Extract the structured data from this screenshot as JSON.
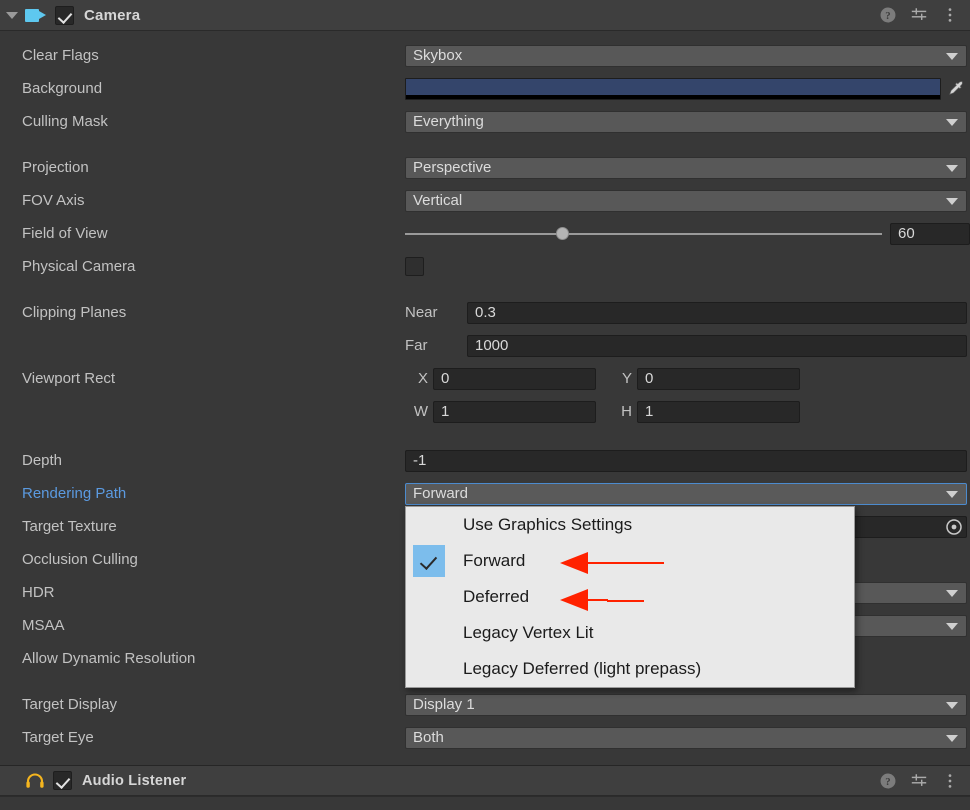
{
  "camera_component": {
    "title": "Camera",
    "icon": "camera-icon",
    "enabled": true,
    "help_icon": "help-icon",
    "preset_icon": "preset-settings-icon",
    "menu_icon": "more-options-icon"
  },
  "audio_component": {
    "title": "Audio Listener",
    "icon": "headphones-icon",
    "enabled": true,
    "help_icon": "help-icon",
    "preset_icon": "preset-settings-icon",
    "menu_icon": "more-options-icon"
  },
  "properties": {
    "clear_flags": {
      "label": "Clear Flags",
      "value": "Skybox"
    },
    "background": {
      "label": "Background",
      "color": "#34456B",
      "alpha_color": "#000000",
      "eyedropper_icon": "eyedropper-icon"
    },
    "culling_mask": {
      "label": "Culling Mask",
      "value": "Everything"
    },
    "projection": {
      "label": "Projection",
      "value": "Perspective"
    },
    "fov_axis": {
      "label": "FOV Axis",
      "value": "Vertical"
    },
    "field_of_view": {
      "label": "Field of View",
      "value": "60",
      "slider_percent": 33
    },
    "physical_camera": {
      "label": "Physical Camera",
      "checked": false
    },
    "clipping_planes": {
      "label": "Clipping Planes",
      "near_label": "Near",
      "near_value": "0.3",
      "far_label": "Far",
      "far_value": "1000"
    },
    "viewport_rect": {
      "label": "Viewport Rect",
      "x_label": "X",
      "x_value": "0",
      "y_label": "Y",
      "y_value": "0",
      "w_label": "W",
      "w_value": "1",
      "h_label": "H",
      "h_value": "1"
    },
    "depth": {
      "label": "Depth",
      "value": "-1"
    },
    "rendering_path": {
      "label": "Rendering Path",
      "value": "Forward",
      "focused": true
    },
    "target_texture": {
      "label": "Target Texture",
      "value": "",
      "picker_icon": "object-picker-icon"
    },
    "occlusion_culling": {
      "label": "Occlusion Culling"
    },
    "hdr": {
      "label": "HDR"
    },
    "msaa": {
      "label": "MSAA"
    },
    "allow_dynamic_resolution": {
      "label": "Allow Dynamic Resolution"
    },
    "target_display": {
      "label": "Target Display",
      "value": "Display 1"
    },
    "target_eye": {
      "label": "Target Eye",
      "value": "Both"
    }
  },
  "rendering_path_popup": {
    "items": [
      {
        "label": "Use Graphics Settings",
        "checked": false
      },
      {
        "label": "Forward",
        "checked": true
      },
      {
        "label": "Deferred",
        "checked": false
      },
      {
        "label": "Legacy Vertex Lit",
        "checked": false
      },
      {
        "label": "Legacy Deferred (light prepass)",
        "checked": false
      }
    ]
  },
  "annotations": {
    "color": "#FF2200",
    "arrows": [
      {
        "points_to": "Forward"
      },
      {
        "points_to": "Deferred"
      }
    ]
  },
  "colors": {
    "background": "#383838",
    "header_bar": "#3F3F3F",
    "dropdown": "#585858",
    "text_field": "#282828",
    "accent_blue": "#5B9AE0",
    "focus_blue": "#4C8BCE",
    "popup_bg": "#E9E9E9",
    "check_highlight": "#7CBDEC",
    "camera_icon": "#5EC8EF",
    "audio_icon": "#F5B51E"
  }
}
